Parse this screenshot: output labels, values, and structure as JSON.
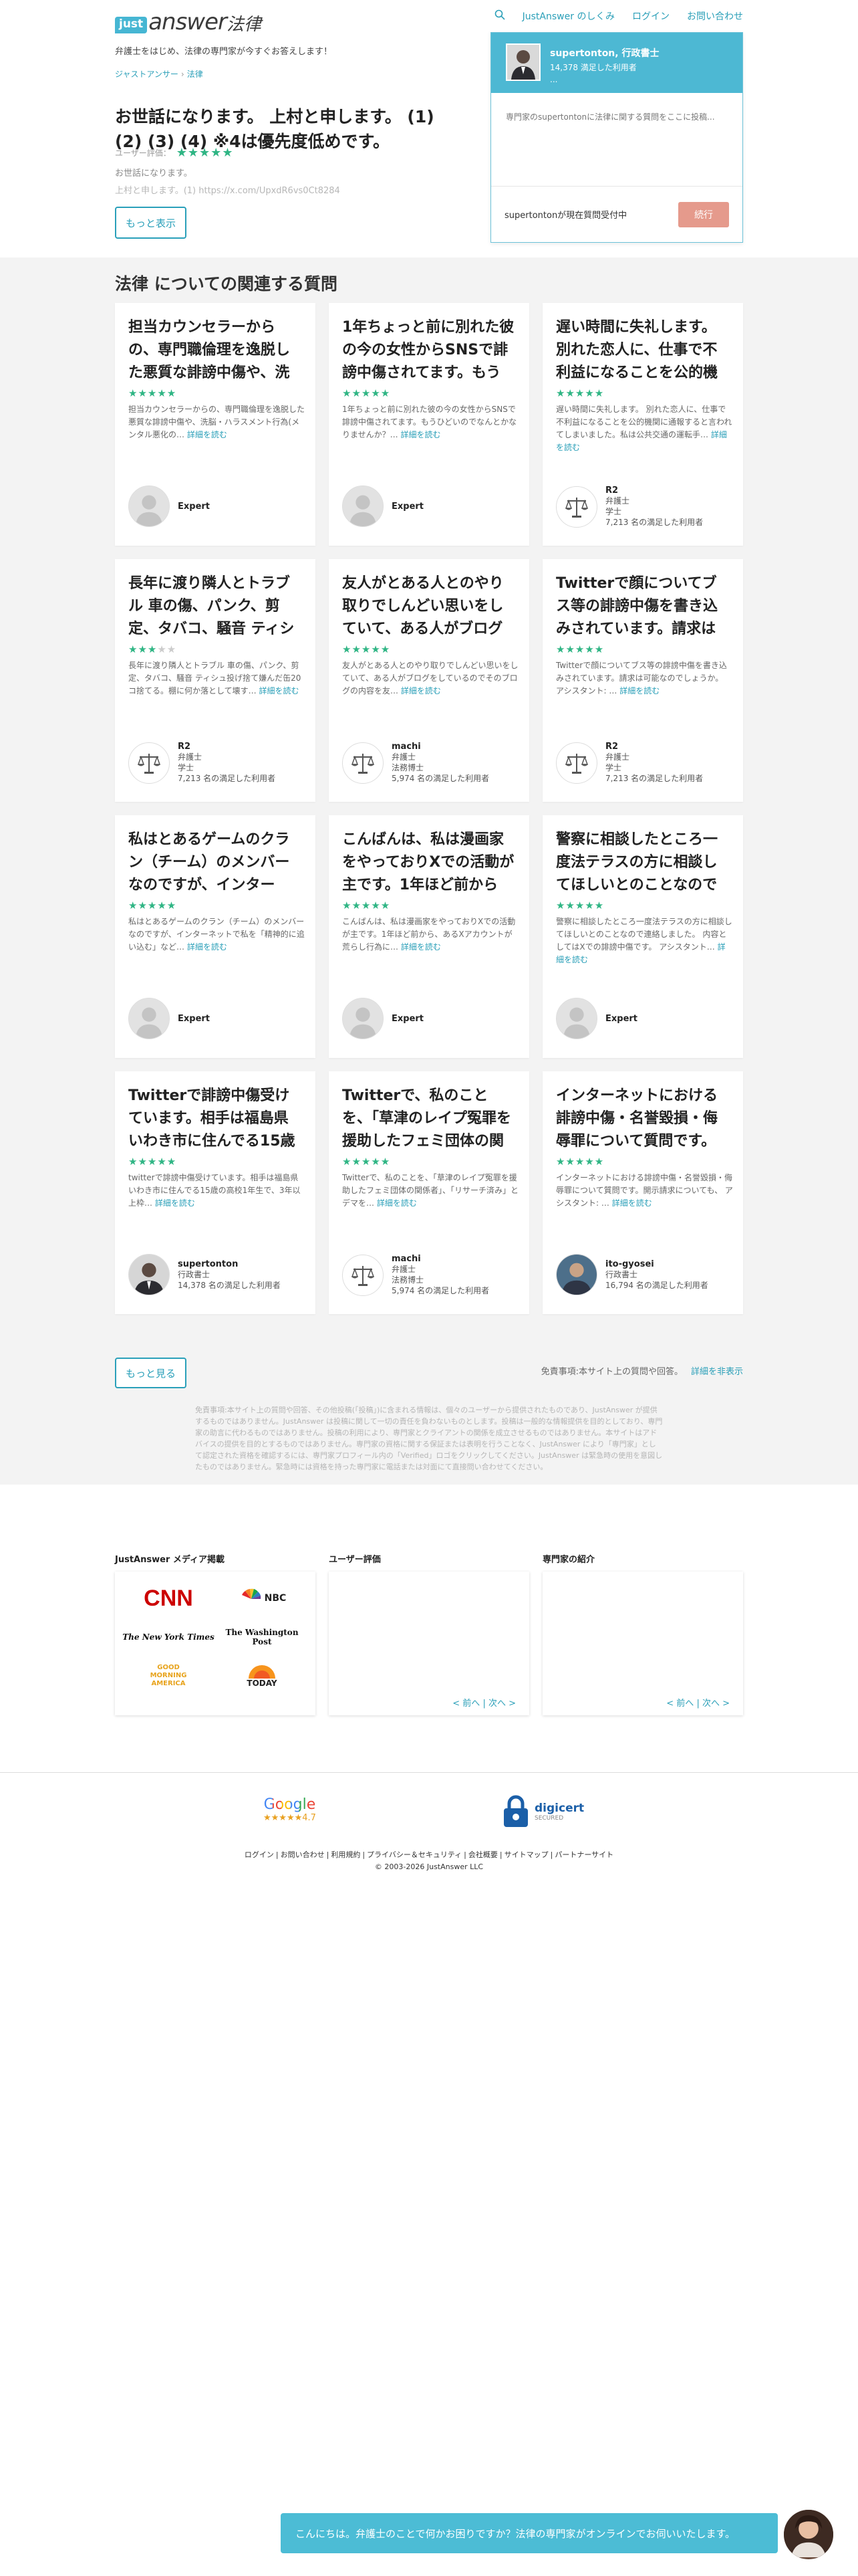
{
  "brand": {
    "logo_just": "just",
    "logo_answer": "answer",
    "logo_law": "法律",
    "tagline": "弁護士をはじめ、法律の専門家が今すぐお答えします！"
  },
  "nav": {
    "howto": "JustAnswer のしくみ",
    "login": "ログイン",
    "contact": "お問い合わせ"
  },
  "breadcrumb": [
    "ジャストアンサー",
    "法律"
  ],
  "question": {
    "title": "お世話になります。 上村と申します。 (1) (2) (3) (4) ※4は優先度低めです。",
    "rating_label": "ユーザー評価：",
    "rating_stars": "★★★★★",
    "body_line1": "お世話になります。",
    "body_line2": "上村と申します。(1) https://x.com/UpxdR6vs0Ct8284",
    "more_label": "もっと表示"
  },
  "expert_panel": {
    "name": "supertonton, 行政書士",
    "satisfied": "14,378 満足した利用者",
    "dots": "...",
    "prompt": "専門家のsupertontonに法律に関する質問をここに投稿...",
    "status": "supertontonが現在質問受付中",
    "continue_label": "続行"
  },
  "related": {
    "heading": "法律 についての関連する質問",
    "read_more": "詳細を読む",
    "cards": [
      {
        "title": "担当カウンセラーからの、専門職倫理を逸脱した悪質な誹謗中傷や、洗脳",
        "stars": "★★★★★",
        "stars_off": "",
        "snippet": "担当カウンセラーからの、専門職倫理を逸脱した悪質な誹謗中傷や、洗脳・ハラスメント行為(メンタル悪化の… ",
        "name": "Expert",
        "role1": "",
        "role2": "",
        "satisfied": "",
        "avatar": "generic"
      },
      {
        "title": "1年ちょっと前に別れた彼の今の女性からSNSで誹謗中傷されてます。もう",
        "stars": "★★★★★",
        "stars_off": "",
        "snippet": "1年ちょっと前に別れた彼の今の女性からSNSで誹謗中傷されてます。もうひどいのでなんとかなりませんか？… ",
        "name": "Expert",
        "role1": "",
        "role2": "",
        "satisfied": "",
        "avatar": "generic"
      },
      {
        "title": "遅い時間に失礼します。別れた恋人に、仕事で不利益になることを公的機",
        "stars": "★★★★★",
        "stars_off": "",
        "snippet": "遅い時間に失礼します。 別れた恋人に、仕事で不利益になることを公的機関に通報すると言われてしまいました。私は公共交通の運転手… ",
        "name": "R2",
        "role1": "弁護士",
        "role2": "学士",
        "satisfied": "7,213 名の満足した利用者",
        "avatar": "scale"
      },
      {
        "title": "長年に渡り隣人とトラブル 車の傷、パンク、剪定、タバコ、騒音 ティシ",
        "stars": "★★★",
        "stars_off": "★★",
        "snippet": "長年に渡り隣人とトラブル 車の傷、パンク、剪定、タバコ、騒音 ティシュ投げ捨て嫌んだ缶20コ捨てる。棚に何か落として壊す… ",
        "name": "R2",
        "role1": "弁護士",
        "role2": "学士",
        "satisfied": "7,213 名の満足した利用者",
        "avatar": "scale"
      },
      {
        "title": "友人がとある人とのやり取りでしんどい思いをしていて、ある人がブログ",
        "stars": "★★★★★",
        "stars_off": "",
        "snippet": "友人がとある人とのやり取りでしんどい思いをしていて、ある人がブログをしているのでそのブログの内容を友… ",
        "name": "machi",
        "role1": "弁護士",
        "role2": "法務博士",
        "satisfied": "5,974 名の満足した利用者",
        "avatar": "scale"
      },
      {
        "title": "Twitterで顔についてブス等の誹謗中傷を書き込みされています。請求は",
        "stars": "★★★★★",
        "stars_off": "",
        "snippet": "Twitterで顔についてブス等の誹謗中傷を書き込みされています。請求は可能なのでしょうか。 アシスタント: … ",
        "name": "R2",
        "role1": "弁護士",
        "role2": "学士",
        "satisfied": "7,213 名の満足した利用者",
        "avatar": "scale"
      },
      {
        "title": "私はとあるゲームのクラン（チーム）のメンバーなのですが、インター",
        "stars": "★★★★★",
        "stars_off": "",
        "snippet": "私はとあるゲームのクラン（チーム）のメンバーなのですが、インターネットで私を「精神的に追い込む」など… ",
        "name": "Expert",
        "role1": "",
        "role2": "",
        "satisfied": "",
        "avatar": "generic"
      },
      {
        "title": "こんばんは、私は漫画家をやっておりXでの活動が主です。1年ほど前から",
        "stars": "★★★★★",
        "stars_off": "",
        "snippet": "こんばんは、私は漫画家をやっておりXでの活動が主です。1年ほど前から、あるXアカウントが荒らし行為に… ",
        "name": "Expert",
        "role1": "",
        "role2": "",
        "satisfied": "",
        "avatar": "generic"
      },
      {
        "title": "警察に相談したところ一度法テラスの方に相談してほしいとのことなので",
        "stars": "★★★★★",
        "stars_off": "",
        "snippet": "警察に相談したところ一度法テラスの方に相談してほしいとのことなので連絡しました。 内容としてはXでの誹謗中傷です。 アシスタント… ",
        "name": "Expert",
        "role1": "",
        "role2": "",
        "satisfied": "",
        "avatar": "generic"
      },
      {
        "title": "Twitterで誹謗中傷受けています。相手は福島県いわき市に住んでる15歳",
        "stars": "★★★★★",
        "stars_off": "",
        "snippet": "twitterで誹謗中傷受けています。相手は福島県いわき市に住んでる15歳の高校1年生で、3年以上枠… ",
        "name": "supertonton",
        "role1": "行政書士",
        "role2": "",
        "satisfied": "14,378 名の満足した利用者",
        "avatar": "photo"
      },
      {
        "title": "Twitterで、私のことを、「草津のレイプ冤罪を援助したフェミ団体の関",
        "stars": "★★★★★",
        "stars_off": "",
        "snippet": "Twitterで、私のことを、「草津のレイプ冤罪を援助したフェミ団体の関係者」、「リサーチ済み」とデマを… ",
        "name": "machi",
        "role1": "弁護士",
        "role2": "法務博士",
        "satisfied": "5,974 名の満足した利用者",
        "avatar": "scale"
      },
      {
        "title": "インターネットにおける誹謗中傷・名誉毀損・侮辱罪について質問です。",
        "stars": "★★★★★",
        "stars_off": "",
        "snippet": "インターネットにおける誹謗中傷・名誉毀損・侮辱罪について質問です。開示請求についても、 アシスタント: … ",
        "name": "ito-gyosei",
        "role1": "行政書士",
        "role2": "",
        "satisfied": "16,794 名の満足した利用者",
        "avatar": "photo2"
      }
    ],
    "more_label": "もっと見る",
    "disclaimer_short": "免責事項:本サイト上の質問や回答。",
    "disclaimer_link": "詳細を非表示",
    "disclaimer_long": "免責事項:本サイト上の質問や回答、その他投稿(「投稿」)に含まれる情報は、個々のユーザーから提供されたものであり、JustAnswer が提供するものではありません。JustAnswer は投稿に関して一切の責任を負わないものとします。投稿は一般的な情報提供を目的としており、専門家の助言に代わるものではありません。投稿の利用により、専門家とクライアントの関係を成立させるものではありません。本サイトはアドバイスの提供を目的とするものではありません。専門家の資格に関する保証または表明を行うことなく、JustAnswer により「専門家」として認定された資格を確認するには、専門家プロフィール内の「Verified」ロゴをクリックしてください。JustAnswer は緊急時の使用を意図したものではありません。緊急時には資格を持った専門家に電話または対面にて直接問い合わせてください。"
  },
  "media": {
    "press_heading": "JustAnswer メディア掲載",
    "press_logos": [
      "CNN",
      "NBC",
      "The New York Times",
      "The Washington Post",
      "GOOD MORNING AMERICA",
      "TODAY"
    ],
    "reviews_heading": "ユーザー評価",
    "experts_heading": "専門家の紹介",
    "prev_label": "< 前へ",
    "sep": "|",
    "next_label": "次へ >"
  },
  "footer": {
    "google_label": "Google",
    "google_rating": "★★★★★4.7",
    "digicert_label": "digicert",
    "digicert_sub": "SECURED",
    "links": [
      "ログイン",
      "お問い合わせ",
      "利用規約",
      "プライバシー＆セキュリティ",
      "会社概要",
      "サイトマップ",
      "パートナーサイト"
    ],
    "copyright": "© 2003-2026 JustAnswer LLC"
  },
  "chat": {
    "message": "こんにちは。弁護士のことで何かお困りですか？法律の専門家がオンラインでお伺いいたします。"
  },
  "colors": {
    "accent": "#46b6d3",
    "link": "#2a9fb8",
    "stars": "#2fb584",
    "continue": "#e59a8c"
  }
}
